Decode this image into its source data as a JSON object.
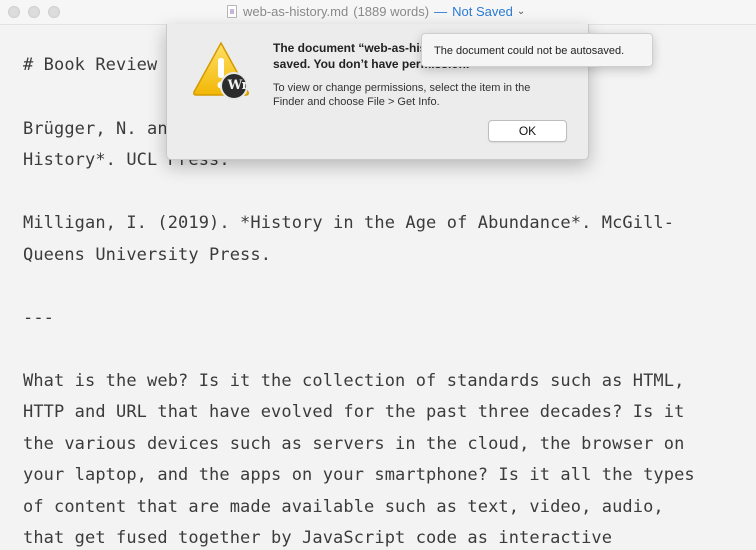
{
  "window": {
    "filename": "web-as-history.md",
    "word_count": "(1889 words)",
    "separator": "—",
    "status": "Not Saved"
  },
  "editor": {
    "lines": [
      "# Book Review",
      "",
      "Brügger, N. and Schroeder, R. (2017). *The Web as",
      "History*. UCL Press.",
      "",
      "Milligan, I. (2019). *History in the Age of Abundance*. McGill-",
      "Queens University Press.",
      "",
      "---",
      "",
      "What is the web? Is it the collection of standards such as HTML,",
      "HTTP and URL that have evolved for the past three decades? Is it",
      "the various devices such as servers in the cloud, the browser on",
      "your laptop, and the apps on your smartphone? Is it all the types",
      "of content that are made available such as text, video, audio,",
      "that get fused together by JavaScript code as interactive"
    ]
  },
  "alert": {
    "title": "The document “web-as-history.md” could not be saved. You don’t have permission.",
    "message": "To view or change permissions, select the item in the Finder and choose File > Get Info.",
    "ok_label": "OK",
    "app_badge": "Wr"
  },
  "tooltip": {
    "text": "The document could not be autosaved."
  }
}
